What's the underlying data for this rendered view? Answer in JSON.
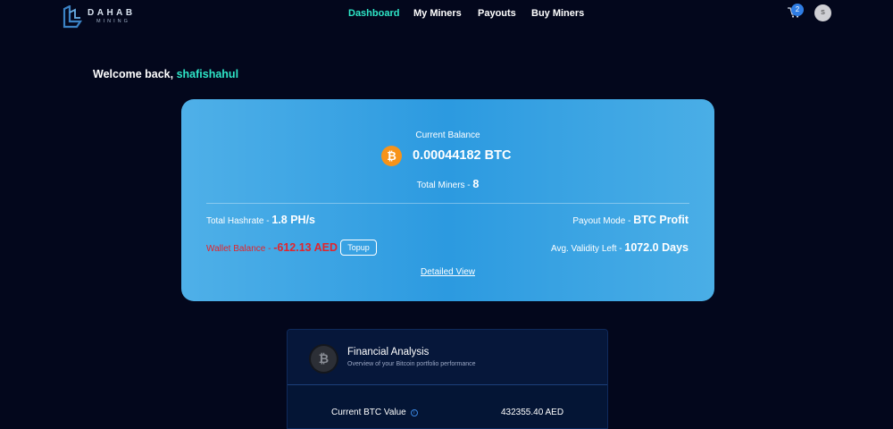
{
  "brand": {
    "name": "DAHAB",
    "tagline": "MINING"
  },
  "nav": [
    {
      "label": "Dashboard",
      "active": true
    },
    {
      "label": "My Miners",
      "active": false
    },
    {
      "label": "Payouts",
      "active": false
    },
    {
      "label": "Buy Miners",
      "active": false
    }
  ],
  "header": {
    "cart_count": "2",
    "avatar_initial": "S"
  },
  "welcome": {
    "prefix": "Welcome back,",
    "username": "shafishahul"
  },
  "balance": {
    "title": "Current Balance",
    "amount": "0.00044182 BTC",
    "total_miners_label": "Total Miners - ",
    "total_miners_value": "8",
    "hashrate_label": "Total Hashrate - ",
    "hashrate_value": "1.8 PH/s",
    "payout_mode_label": "Payout Mode - ",
    "payout_mode_value": "BTC Profit",
    "wallet_label": "Wallet Balance - ",
    "wallet_value": "-612.13 AED",
    "topup_label": "Topup",
    "validity_label": "Avg. Validity Left - ",
    "validity_value": "1072.0 Days",
    "detail_link": "Detailed View"
  },
  "financial": {
    "title": "Financial Analysis",
    "subtitle": "Overview of your Bitcoin portfolio performance",
    "rows": [
      {
        "label": "Current BTC Value",
        "value": "432355.40 AED"
      }
    ]
  },
  "colors": {
    "accent": "#2ee6c7",
    "card": "#2c9ae0",
    "negative": "#e3242b",
    "btc": "#f7931a"
  }
}
